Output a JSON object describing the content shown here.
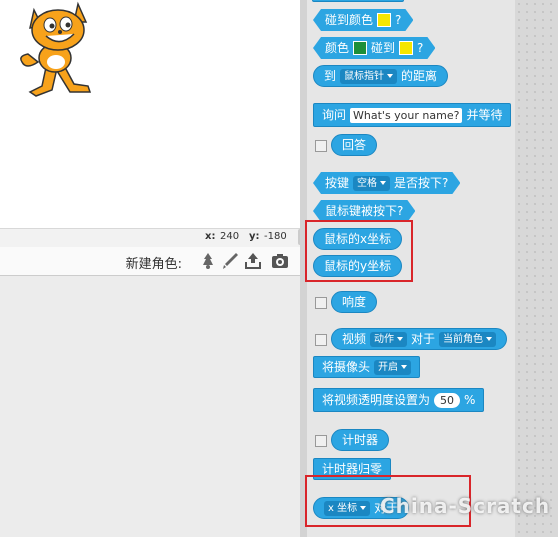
{
  "coords": {
    "x_label": "x:",
    "x_value": "240",
    "y_label": "y:",
    "y_value": "-180"
  },
  "sprites": {
    "new_sprite_label": "新建角色:"
  },
  "blocks": {
    "touch_color": {
      "label": "碰到颜色",
      "q": "?"
    },
    "color_touch": {
      "pre": "颜色",
      "mid": "碰到",
      "q": "?"
    },
    "distance": {
      "pre": "到",
      "target": "鼠标指针",
      "post": "的距离"
    },
    "ask": {
      "pre": "询问",
      "input": "What's your name?",
      "post": "并等待"
    },
    "answer": "回答",
    "key_pressed": {
      "pre": "按键",
      "key": "空格",
      "post": "是否按下?"
    },
    "mouse_down": "鼠标键被按下?",
    "mouse_x": "鼠标的x坐标",
    "mouse_y": "鼠标的y坐标",
    "loudness": "响度",
    "video": {
      "pre": "视频",
      "attr": "动作",
      "mid": "对于",
      "target": "当前角色"
    },
    "camera": {
      "pre": "将摄像头",
      "state": "开启"
    },
    "transparency": {
      "pre": "将视频透明度设置为",
      "value": "50",
      "post": "%"
    },
    "timer": "计时器",
    "timer_reset": "计时器归零",
    "of_block": {
      "attr": "x 坐标",
      "post": "对于"
    }
  },
  "colors": {
    "sensing_block": "#2ca5e2",
    "highlight": "#d9252a",
    "swatch_yellow": "#f5e600",
    "swatch_green": "#1d8f3a"
  },
  "watermark": "China-Scratch"
}
